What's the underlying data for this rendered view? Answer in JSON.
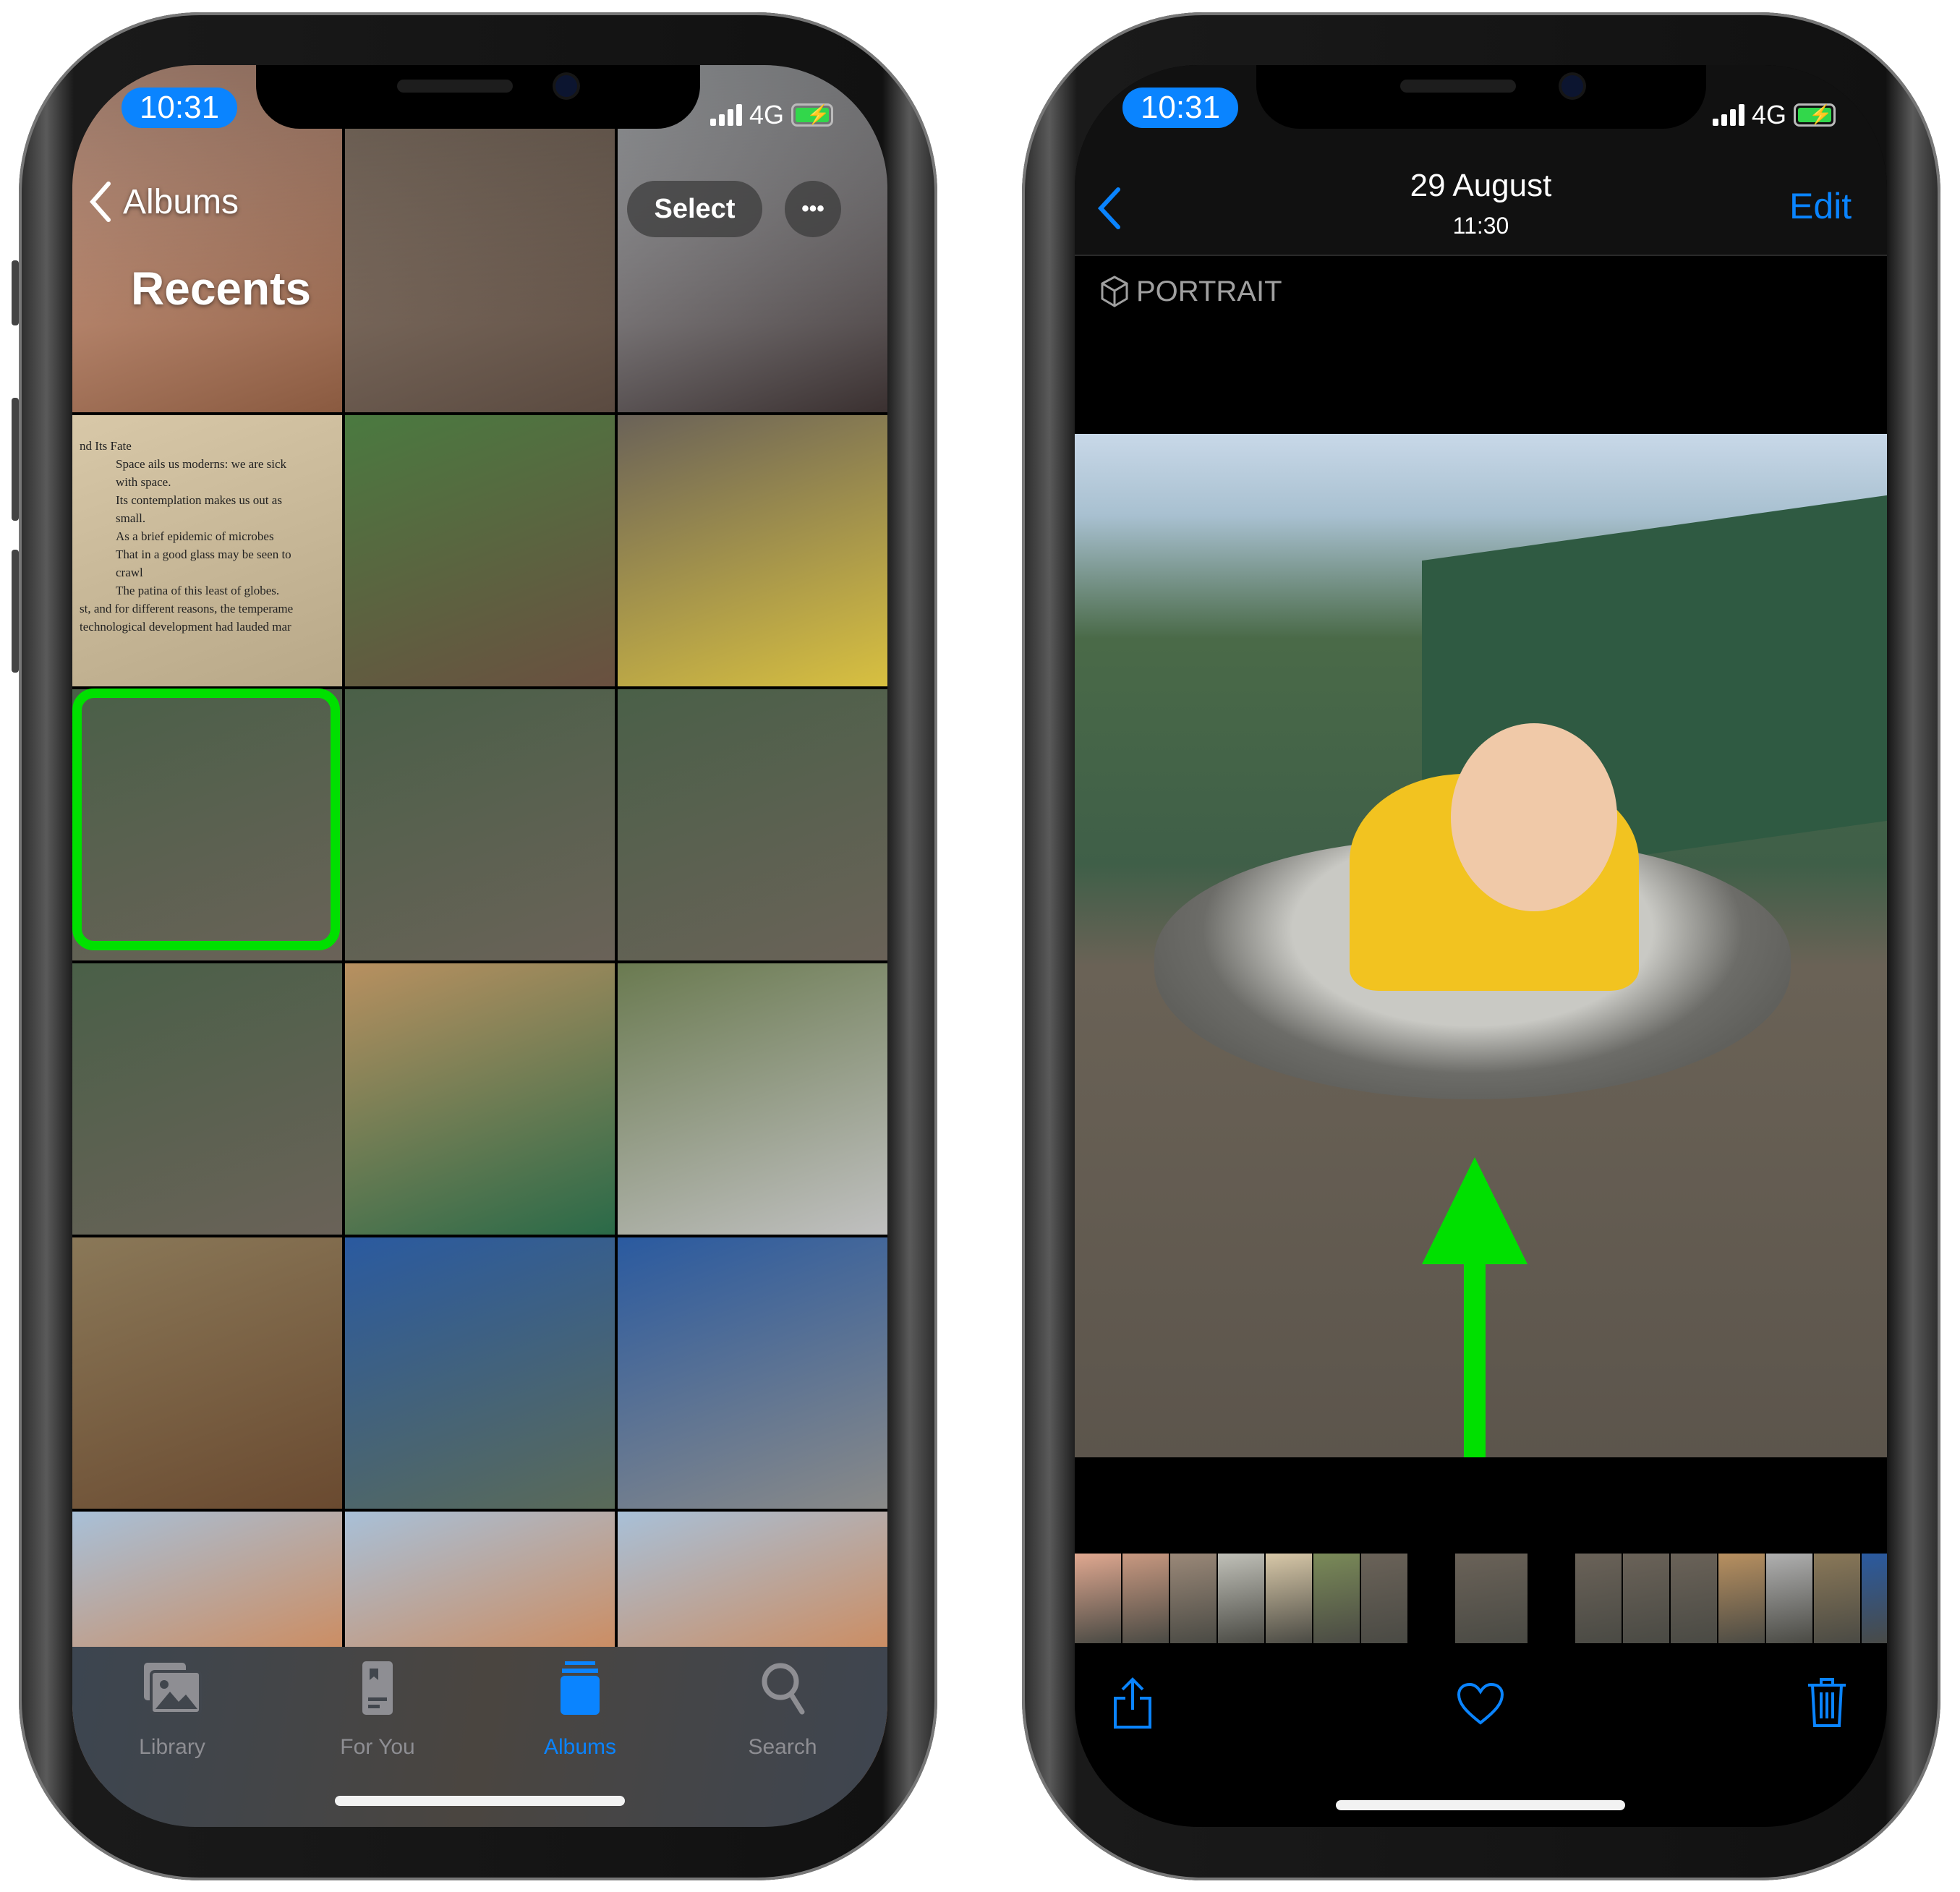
{
  "left_phone": {
    "status": {
      "time": "10:31",
      "network": "4G"
    },
    "header": {
      "back_label": "Albums",
      "title": "Recents",
      "select_label": "Select",
      "more_label": "•••"
    },
    "tabs": [
      {
        "label": "Library",
        "icon": "photo-stack-icon"
      },
      {
        "label": "For You",
        "icon": "for-you-icon"
      },
      {
        "label": "Albums",
        "icon": "albums-icon",
        "active": true
      },
      {
        "label": "Search",
        "icon": "search-icon"
      }
    ],
    "highlight_color": "#00e000",
    "book_text": [
      "nd Its Fate",
      "Space ails us moderns: we are sick",
      "with space.",
      "Its contemplation makes us out as",
      "small.",
      "As a brief epidemic of microbes",
      "That in a good glass may be seen to",
      "crawl",
      "The patina of this least of globes.",
      "st, and for different reasons, the temperame",
      "technological development had lauded mar"
    ]
  },
  "right_phone": {
    "status": {
      "time": "10:31",
      "network": "4G"
    },
    "nav": {
      "title": "29 August",
      "subtitle": "11:30",
      "edit_label": "Edit"
    },
    "badge": "PORTRAIT",
    "accent": "#0a84ff",
    "arrow_color": "#00e000"
  }
}
